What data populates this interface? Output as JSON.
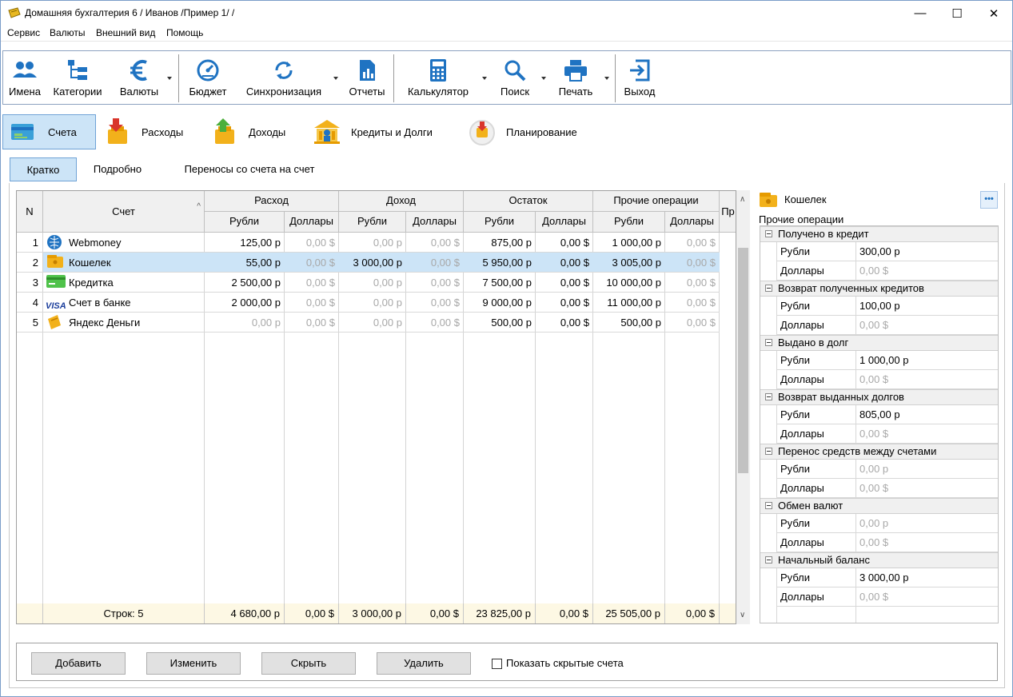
{
  "window": {
    "title": "Домашняя бухгалтерия 6  / Иванов /Пример 1/ /",
    "minimize": "—",
    "maximize": "☐",
    "close": "✕"
  },
  "menu": [
    "Сервис",
    "Валюты",
    "Внешний вид",
    "Помощь"
  ],
  "toolbar": [
    {
      "label": "Имена",
      "icon": "users-icon"
    },
    {
      "label": "Категории",
      "icon": "categories-icon"
    },
    {
      "label": "Валюты",
      "icon": "euro-icon"
    },
    {
      "label": "Бюджет",
      "icon": "gauge-icon"
    },
    {
      "label": "Синхронизация",
      "icon": "sync-icon"
    },
    {
      "label": "Отчеты",
      "icon": "report-icon"
    },
    {
      "label": "Калькулятор",
      "icon": "calculator-icon"
    },
    {
      "label": "Поиск",
      "icon": "search-icon"
    },
    {
      "label": "Печать",
      "icon": "printer-icon"
    },
    {
      "label": "Выход",
      "icon": "exit-icon"
    }
  ],
  "nav": [
    {
      "label": "Счета",
      "active": true
    },
    {
      "label": "Расходы"
    },
    {
      "label": "Доходы"
    },
    {
      "label": "Кредиты и Долги"
    },
    {
      "label": "Планирование"
    }
  ],
  "subtabs": [
    {
      "label": "Кратко",
      "active": true
    },
    {
      "label": "Подробно"
    },
    {
      "label": "Переносы со счета на счет"
    }
  ],
  "grid": {
    "col_n": "N",
    "col_account": "Счет",
    "groups": [
      "Расход",
      "Доход",
      "Остаток",
      "Прочие операции",
      "Пр"
    ],
    "subcols": [
      "Рубли",
      "Доллары",
      "Рубли",
      "Доллары",
      "Рубли",
      "Доллары",
      "Рубли",
      "Доллары"
    ],
    "rows": [
      {
        "n": "1",
        "name": "Webmoney",
        "icon": "webmoney-icon",
        "vals": [
          "125,00 р",
          "0,00 $",
          "0,00 р",
          "0,00 $",
          "875,00 р",
          "0,00 $",
          "1 000,00 р",
          "0,00 $"
        ],
        "dim": [
          false,
          true,
          true,
          true,
          false,
          false,
          false,
          true
        ]
      },
      {
        "n": "2",
        "name": "Кошелек",
        "icon": "wallet-icon",
        "vals": [
          "55,00 р",
          "0,00 $",
          "3 000,00 р",
          "0,00 $",
          "5 950,00 р",
          "0,00 $",
          "3 005,00 р",
          "0,00 $"
        ],
        "dim": [
          false,
          true,
          false,
          true,
          false,
          false,
          false,
          true
        ],
        "selected": true
      },
      {
        "n": "3",
        "name": "Кредитка",
        "icon": "card-icon",
        "vals": [
          "2 500,00 р",
          "0,00 $",
          "0,00 р",
          "0,00 $",
          "7 500,00 р",
          "0,00 $",
          "10 000,00 р",
          "0,00 $"
        ],
        "dim": [
          false,
          true,
          true,
          true,
          false,
          false,
          false,
          true
        ]
      },
      {
        "n": "4",
        "name": "Счет в банке",
        "icon": "visa-icon",
        "vals": [
          "2 000,00 р",
          "0,00 $",
          "0,00 р",
          "0,00 $",
          "9 000,00 р",
          "0,00 $",
          "11 000,00 р",
          "0,00 $"
        ],
        "dim": [
          false,
          true,
          true,
          true,
          false,
          false,
          false,
          true
        ]
      },
      {
        "n": "5",
        "name": "Яндекс Деньги",
        "icon": "yandex-money-icon",
        "vals": [
          "0,00 р",
          "0,00 $",
          "0,00 р",
          "0,00 $",
          "500,00 р",
          "0,00 $",
          "500,00 р",
          "0,00 $"
        ],
        "dim": [
          true,
          true,
          true,
          true,
          false,
          false,
          false,
          true
        ]
      }
    ],
    "visa_text": "VISA",
    "footer_label": "Строк: 5",
    "footer_vals": [
      "4 680,00 р",
      "0,00 $",
      "3 000,00 р",
      "0,00 $",
      "23 825,00 р",
      "0,00 $",
      "25 505,00 р",
      "0,00 $"
    ]
  },
  "right_panel": {
    "account": "Кошелек",
    "more": "•••",
    "section": "Прочие операции",
    "groups": [
      {
        "title": "Получено в кредит",
        "rub": "300,00 р",
        "usd": "0,00 $",
        "rub_dim": false
      },
      {
        "title": "Возврат полученных кредитов",
        "rub": "100,00 р",
        "usd": "0,00 $",
        "rub_dim": false
      },
      {
        "title": "Выдано в долг",
        "rub": "1 000,00 р",
        "usd": "0,00 $",
        "rub_dim": false
      },
      {
        "title": "Возврат выданных долгов",
        "rub": "805,00 р",
        "usd": "0,00 $",
        "rub_dim": false
      },
      {
        "title": "Перенос средств между счетами",
        "rub": "0,00 р",
        "usd": "0,00 $",
        "rub_dim": true
      },
      {
        "title": "Обмен валют",
        "rub": "0,00 р",
        "usd": "0,00 $",
        "rub_dim": true
      },
      {
        "title": "Начальный баланс",
        "rub": "3 000,00 р",
        "usd": "0,00 $",
        "rub_dim": false
      }
    ],
    "rub_label": "Рубли",
    "usd_label": "Доллары"
  },
  "buttons": {
    "add": "Добавить",
    "edit": "Изменить",
    "hide": "Скрыть",
    "delete": "Удалить",
    "show_hidden": "Показать скрытые счета"
  },
  "colors": {
    "accent": "#1f73c2",
    "selected_row": "#cce4f7",
    "footer_bg": "#fdf8e4"
  }
}
